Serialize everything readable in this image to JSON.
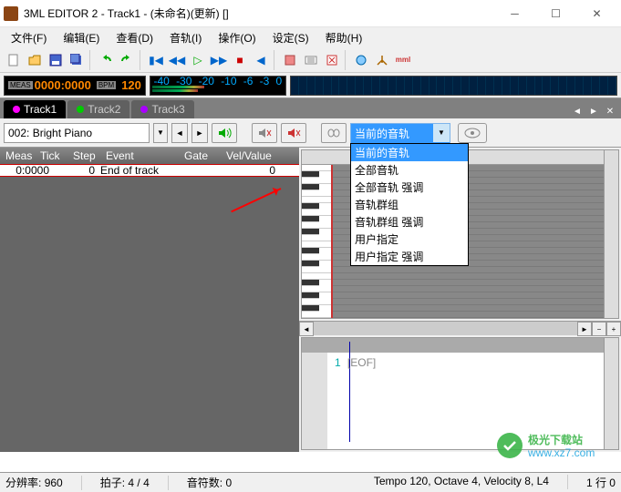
{
  "window": {
    "title": "3ML EDITOR 2 - Track1 - (未命名)(更新) []"
  },
  "menu": {
    "file": "文件(F)",
    "edit": "编辑(E)",
    "view": "查看(D)",
    "track": "音轨(I)",
    "operate": "操作(O)",
    "settings": "设定(S)",
    "help": "帮助(H)"
  },
  "counter": {
    "meas_label": "MEAS",
    "meas_value": "0000:0000",
    "bpm_label": "BPM",
    "bpm_value": "120"
  },
  "meter_scale": [
    "-40",
    "-30",
    "-20",
    "-10",
    "-6",
    "-3",
    "0"
  ],
  "tabs": [
    {
      "label": "Track1",
      "active": true
    },
    {
      "label": "Track2",
      "active": false
    },
    {
      "label": "Track3",
      "active": false
    }
  ],
  "instrument": {
    "name": "002: Bright Piano"
  },
  "dropdown": {
    "selected": "当前的音轨",
    "options": [
      "当前的音轨",
      "全部音轨",
      "全部音轨 强调",
      "音轨群组",
      "音轨群组 强调",
      "用户指定",
      "用户指定 强调"
    ]
  },
  "event_header": {
    "meas": "Meas",
    "tick": "Tick",
    "step": "Step",
    "event": "Event",
    "gate": "Gate",
    "vel": "Vel/Value"
  },
  "event_row": {
    "meas": "0:0000",
    "step": "0",
    "event": "End of track",
    "value": "0"
  },
  "lower": {
    "line_no": "1",
    "eof": "[EOF]"
  },
  "status": {
    "resolution_label": "分辨率:",
    "resolution_value": "960",
    "beat_label": "拍子:",
    "beat_value": "4 / 4",
    "notes_label": "音符数:",
    "notes_value": "0",
    "tempo_info": "Tempo 120, Octave 4, Velocity  8, L4",
    "position": "1 行 0"
  },
  "watermark": {
    "text": "极光下载站",
    "url": "www.xz7.com"
  }
}
